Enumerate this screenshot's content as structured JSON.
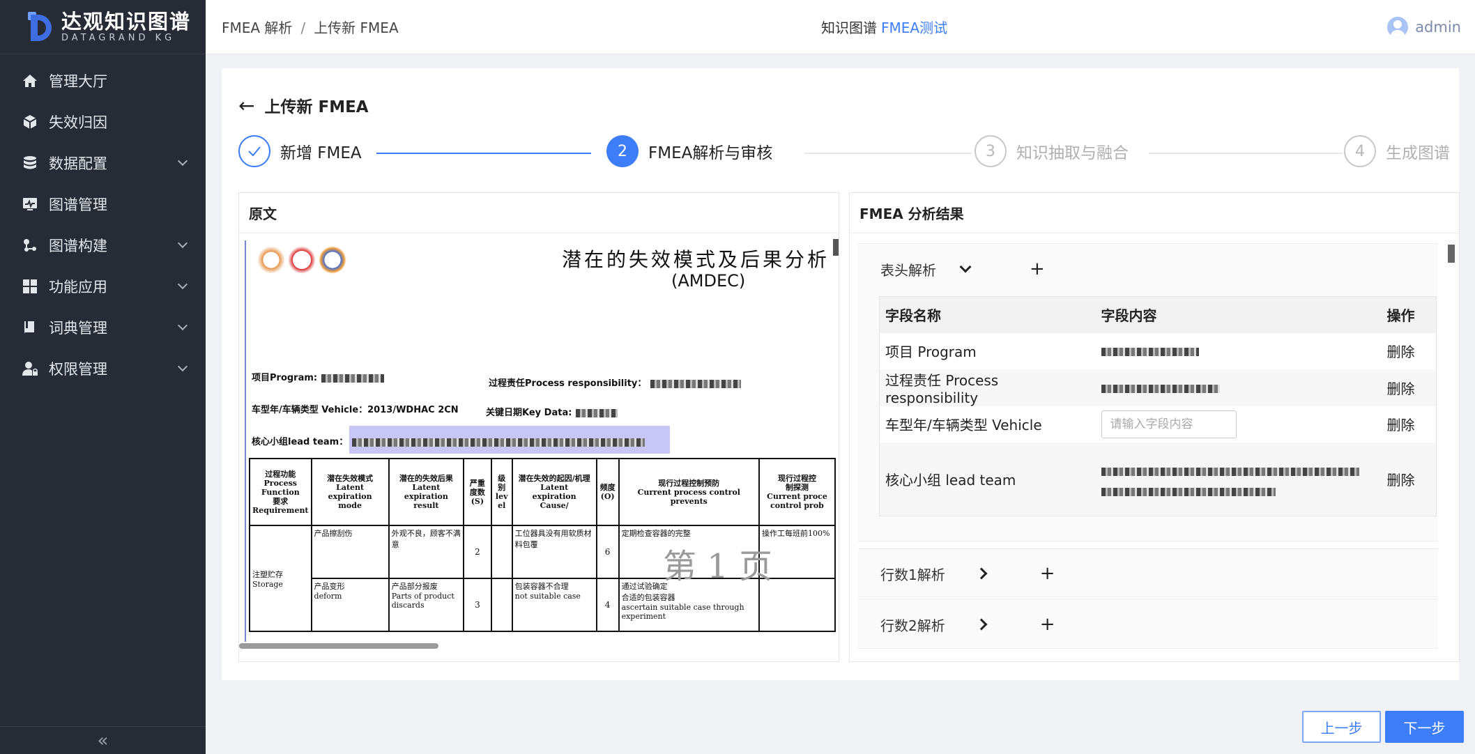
{
  "app": {
    "logo_cn": "达观知识图谱",
    "logo_en": "DATAGRAND KG"
  },
  "sidebar": {
    "items": [
      {
        "label": "管理大厅",
        "icon": "home-icon",
        "has_children": false
      },
      {
        "label": "失效归因",
        "icon": "cube-icon",
        "has_children": false
      },
      {
        "label": "数据配置",
        "icon": "database-icon",
        "has_children": true
      },
      {
        "label": "图谱管理",
        "icon": "monitor-icon",
        "has_children": false
      },
      {
        "label": "图谱构建",
        "icon": "nodes-icon",
        "has_children": true
      },
      {
        "label": "功能应用",
        "icon": "grid-icon",
        "has_children": true
      },
      {
        "label": "词典管理",
        "icon": "book-icon",
        "has_children": true
      },
      {
        "label": "权限管理",
        "icon": "user-lock-icon",
        "has_children": true
      }
    ],
    "collapse_glyph": "«"
  },
  "header": {
    "breadcrumb": [
      "FMEA 解析",
      "上传新 FMEA"
    ],
    "center_label": "知识图谱",
    "project": "FMEA测试",
    "user": "admin"
  },
  "page": {
    "title": "上传新 FMEA",
    "steps": [
      {
        "num": "✓",
        "label": "新增 FMEA",
        "state": "done"
      },
      {
        "num": "2",
        "label": "FMEA解析与审核",
        "state": "active"
      },
      {
        "num": "3",
        "label": "知识抽取与融合",
        "state": "wait"
      },
      {
        "num": "4",
        "label": "生成图谱",
        "state": "wait"
      }
    ]
  },
  "left_panel": {
    "title": "原文",
    "doc": {
      "title_cn": "潜在的失效模式及后果分析",
      "title_fr": "(AMDEC)",
      "program": "项目Program:",
      "process_resp": "过程责任Process responsibility：",
      "vehicle": "车型年/车辆类型 Vehicle：",
      "vehicle_val": "2013/WDHAC 2CN",
      "key_data": "关键日期Key Data:",
      "lead_team": "核心小组lead team：",
      "headers": [
        "过程功能\nProcess\nFunction\n要求\nRequirement",
        "潜在失效模式\nLatent\nexpiration\nmode",
        "潜在的失效后果\nLatent\nexpiration\nresult",
        "严重\n度数\n(S)",
        "级别\nlev\nel",
        "潜在失效的起因/机理\nLatent\nexpiration\nCause/",
        "频度\n(O)",
        "现行过程控制预防\nCurrent process control\nprevents",
        "现行过程控\n制探测\nCurrent proce\ncontrol prob"
      ],
      "function_cell": "注塑贮存\nStorage",
      "rows": [
        {
          "mode": "产品擦刮伤",
          "result": "外观不良，顾客不满意",
          "s": "2",
          "cause": "工位器具没有用软质材料包覆",
          "o": "6",
          "prevent": "定期检查容器的完整",
          "detect": "操作工每班前100%"
        },
        {
          "mode": "产品变形\ndeform",
          "result": "产品部分报废\nParts of product discards",
          "s": "3",
          "cause": "包装容器不合理\nnot suitable case",
          "o": "4",
          "prevent": "通过试验确定\n合适的包装容器\nascertain  suitable case through experiment",
          "detect": ""
        }
      ],
      "watermark": "第 1 页"
    }
  },
  "right_panel": {
    "title": "FMEA 分析结果",
    "header_section": {
      "label": "表头解析",
      "add": "+"
    },
    "table": {
      "columns": [
        "字段名称",
        "字段内容",
        "操作"
      ],
      "rows": [
        {
          "name": "项目 Program",
          "value": "",
          "action": "删除"
        },
        {
          "name": "过程责任 Process responsibility",
          "value": "",
          "action": "删除"
        },
        {
          "name": "车型年/车辆类型 Vehicle",
          "value": "",
          "placeholder": "请输入字段内容",
          "action": "删除"
        },
        {
          "name": "核心小组 lead team",
          "value": "",
          "action": "删除"
        }
      ]
    },
    "row_sections": [
      {
        "label": "行数1解析",
        "add": "+"
      },
      {
        "label": "行数2解析",
        "add": "+"
      }
    ]
  },
  "footer": {
    "prev": "上一步",
    "next": "下一步"
  },
  "colors": {
    "accent": "#3d7ef8",
    "sidebar_bg": "#262b36"
  }
}
